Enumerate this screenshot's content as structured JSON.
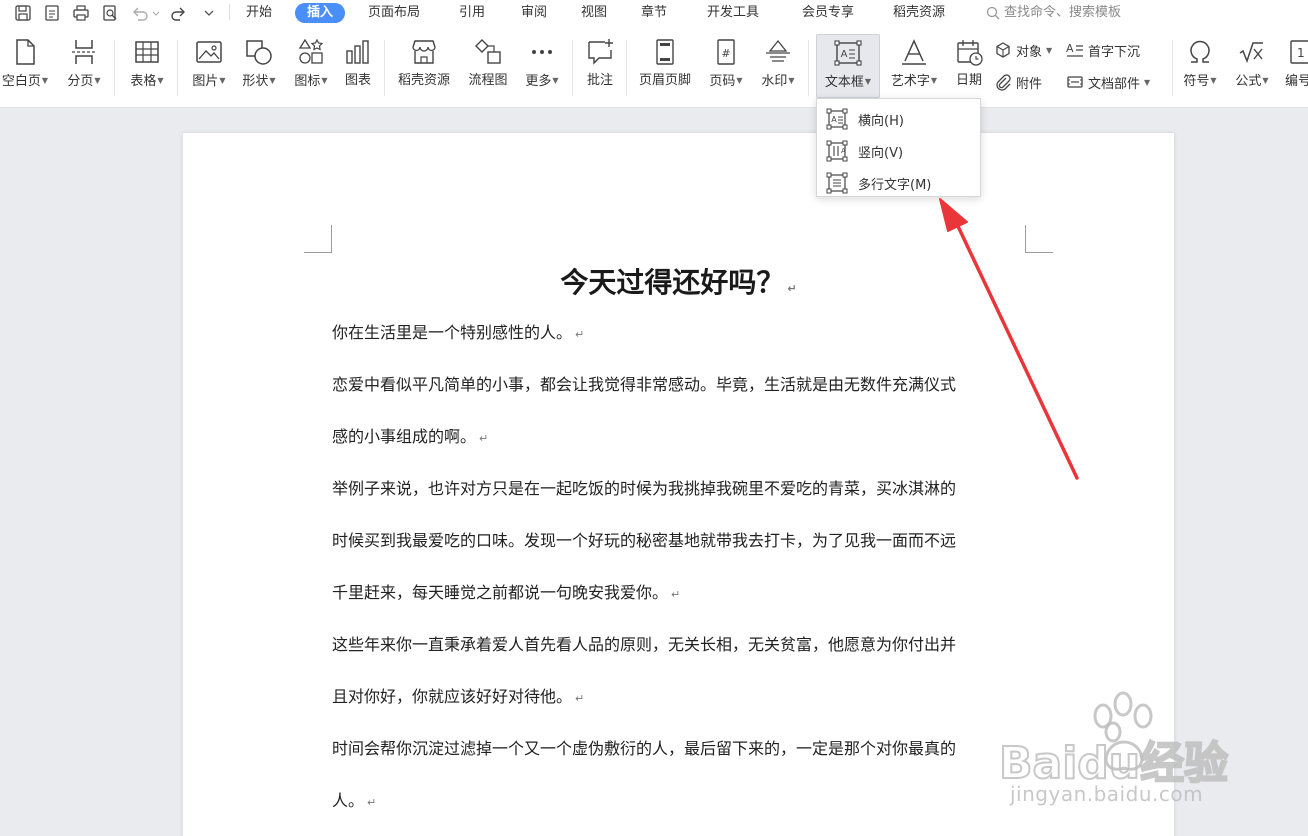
{
  "menu": {
    "items": [
      "开始",
      "插入",
      "页面布局",
      "引用",
      "审阅",
      "视图",
      "章节",
      "开发工具",
      "会员专享",
      "稻壳资源"
    ],
    "active_index": 1,
    "search_placeholder": "查找命令、搜索模板"
  },
  "ribbon": {
    "blank_page": "空白页",
    "page_break": "分页",
    "table": "表格",
    "picture": "图片",
    "shape": "形状",
    "icon": "图标",
    "chart": "图表",
    "docer_resource": "稻壳资源",
    "flowchart": "流程图",
    "more": "更多",
    "comment": "批注",
    "header_footer": "页眉页脚",
    "page_number": "页码",
    "watermark": "水印",
    "textbox": "文本框",
    "wordart": "艺术字",
    "date": "日期",
    "object": "对象",
    "drop_cap": "首字下沉",
    "attachment": "附件",
    "doc_parts": "文档部件",
    "symbol": "符号",
    "formula": "公式",
    "numbering": "编号"
  },
  "textbox_menu": {
    "items": [
      "横向(H)",
      "竖向(V)",
      "多行文字(M)"
    ]
  },
  "document": {
    "title": "今天过得还好吗？",
    "lines": [
      "你在生活里是一个特别感性的人。",
      "恋爱中看似平凡简单的小事，都会让我觉得非常感动。毕竟，生活就是由无数件充满仪式",
      "感的小事组成的啊。",
      "举例子来说，也许对方只是在一起吃饭的时候为我挑掉我碗里不爱吃的青菜，买冰淇淋的",
      "时候买到我最爱吃的口味。发现一个好玩的秘密基地就带我去打卡，为了见我一面而不远",
      "千里赶来，每天睡觉之前都说一句晚安我爱你。",
      "这些年来你一直秉承着爱人首先看人品的原则，无关长相，无关贫富，他愿意为你付出并",
      "且对你好，你就应该好好对待他。",
      "时间会帮你沉淀过滤掉一个又一个虚伪敷衍的人，最后留下来的，一定是那个对你最真的",
      "人。"
    ],
    "return_mark": "↵"
  },
  "watermark": {
    "brand": "Baidu经验",
    "url": "jingyan.baidu.com"
  },
  "colors": {
    "accent": "#4a8ef7",
    "arrow": "#e8363a"
  }
}
